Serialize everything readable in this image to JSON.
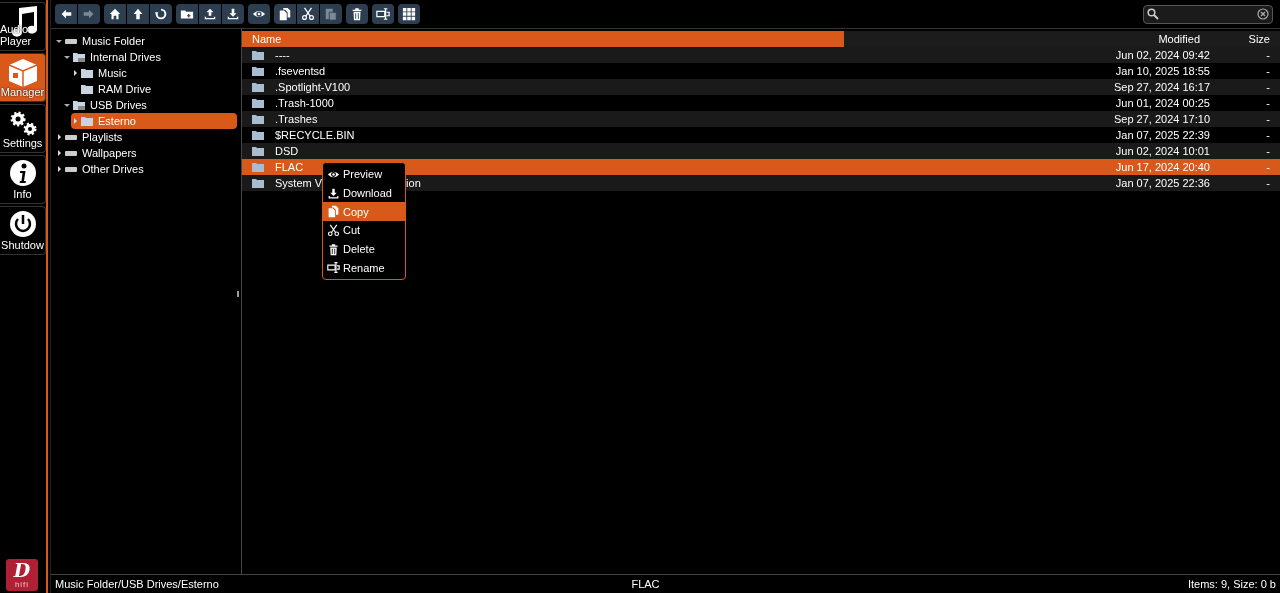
{
  "nav": [
    {
      "label": "Audio Player",
      "selected": false
    },
    {
      "label": "Manager",
      "selected": true
    },
    {
      "label": "Settings",
      "selected": false
    },
    {
      "label": "Info",
      "selected": false
    },
    {
      "label": "Shutdow",
      "selected": false
    }
  ],
  "logo": {
    "mark": "D",
    "caption": "hifi"
  },
  "toolbar": [
    [
      {
        "disabled": false
      },
      {
        "disabled": true
      }
    ],
    [
      {
        "disabled": false
      },
      {
        "disabled": false
      },
      {
        "disabled": false
      }
    ],
    [
      {
        "disabled": false
      },
      {
        "disabled": false
      },
      {
        "disabled": false
      }
    ],
    [
      {
        "disabled": false
      }
    ],
    [
      {
        "disabled": false
      },
      {
        "disabled": false
      },
      {
        "disabled": true
      }
    ],
    [
      {
        "disabled": false
      }
    ],
    [
      {
        "disabled": false
      }
    ],
    [
      {
        "disabled": false
      }
    ]
  ],
  "tree": [
    {
      "label": "Music Folder",
      "kind": "drive",
      "expanded": true,
      "selected": false,
      "children": [
        {
          "label": "Internal Drives",
          "kind": "folderdrive",
          "expanded": true,
          "selected": false,
          "children": [
            {
              "label": "Music",
              "kind": "folder",
              "expanded": false,
              "selected": false
            },
            {
              "label": "RAM Drive",
              "kind": "folder",
              "selected": false
            }
          ]
        },
        {
          "label": "USB Drives",
          "kind": "folderdrive",
          "expanded": true,
          "selected": false,
          "children": [
            {
              "label": "Esterno",
              "kind": "folder",
              "expanded": false,
              "selected": true
            }
          ]
        }
      ]
    },
    {
      "label": "Playlists",
      "kind": "drive",
      "expanded": false,
      "selected": false
    },
    {
      "label": "Wallpapers",
      "kind": "drive",
      "expanded": false,
      "selected": false
    },
    {
      "label": "Other Drives",
      "kind": "drive",
      "expanded": false,
      "selected": false
    }
  ],
  "table": {
    "columns": [
      "Name",
      "Modified",
      "Size"
    ],
    "rows": [
      {
        "name": "----",
        "modified": "Jun 02, 2024 09:42",
        "size": "-",
        "selected": false
      },
      {
        "name": ".fseventsd",
        "modified": "Jan 10, 2025 18:55",
        "size": "-",
        "selected": false
      },
      {
        "name": ".Spotlight-V100",
        "modified": "Sep 27, 2024 16:17",
        "size": "-",
        "selected": false
      },
      {
        "name": ".Trash-1000",
        "modified": "Jun 01, 2024 00:25",
        "size": "-",
        "selected": false
      },
      {
        "name": ".Trashes",
        "modified": "Sep 27, 2024 17:10",
        "size": "-",
        "selected": false
      },
      {
        "name": "$RECYCLE.BIN",
        "modified": "Jan 07, 2025 22:39",
        "size": "-",
        "selected": false
      },
      {
        "name": "DSD",
        "modified": "Jun 02, 2024 10:01",
        "size": "-",
        "selected": false
      },
      {
        "name": "FLAC",
        "modified": "Jun 17, 2024 20:40",
        "size": "-",
        "selected": true
      },
      {
        "name": "System V",
        "name_tail": "ion",
        "modified": "Jan 07, 2025 22:36",
        "size": "-",
        "selected": false
      }
    ]
  },
  "context_menu": [
    {
      "label": "Preview",
      "selected": false
    },
    {
      "label": "Download",
      "selected": false
    },
    {
      "label": "Copy",
      "selected": true
    },
    {
      "label": "Cut",
      "selected": false
    },
    {
      "label": "Delete",
      "selected": false
    },
    {
      "label": "Rename",
      "selected": false
    }
  ],
  "status_bar": {
    "path": "Music Folder/USB Drives/Esterno",
    "selection": "FLAC",
    "summary": "Items: 9, Size: 0 b"
  }
}
